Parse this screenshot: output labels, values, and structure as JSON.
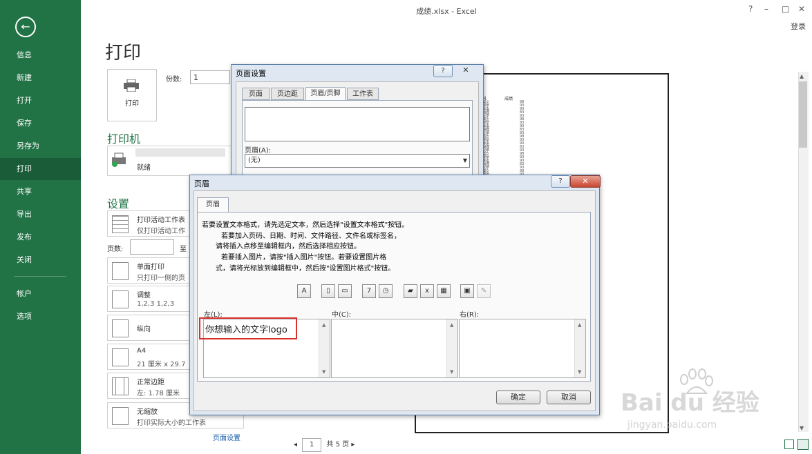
{
  "window": {
    "title": "成绩.xlsx - Excel",
    "help": "?",
    "minimize": "–",
    "maximize": "□",
    "close": "✕",
    "login": "登录"
  },
  "nav": {
    "back_icon": "←",
    "items": [
      {
        "label": "信息"
      },
      {
        "label": "新建"
      },
      {
        "label": "打开"
      },
      {
        "label": "保存"
      },
      {
        "label": "另存为"
      },
      {
        "label": "打印"
      },
      {
        "label": "共享"
      },
      {
        "label": "导出"
      },
      {
        "label": "发布"
      },
      {
        "label": "关闭"
      },
      {
        "label": "帐户"
      },
      {
        "label": "选项"
      }
    ]
  },
  "print": {
    "title": "打印",
    "button": "打印",
    "copies_label": "份数:",
    "copies_value": "1",
    "printer_section": "打印机",
    "printer_status": "就绪",
    "settings_section": "设置",
    "settings": [
      {
        "line1": "打印活动工作表",
        "line2": "仅打印活动工作"
      },
      {
        "line1": "单面打印",
        "line2": "只打印一侧的页"
      },
      {
        "line1": "调整",
        "line2": "1,2,3    1,2,3"
      },
      {
        "line1": "纵向",
        "line2": ""
      },
      {
        "line1": "A4",
        "line2": "21 厘米 x 29.7"
      },
      {
        "line1": "正常边距",
        "line2": "左: 1.78 厘米"
      },
      {
        "line1": "无缩放",
        "line2": "打印实际大小的工作表"
      }
    ],
    "pages_label": "页数:",
    "pages_to": "至",
    "page_setup_link": "页面设置",
    "pager_current": "1",
    "pager_total": "共 5 页"
  },
  "preview": {
    "col_a": "科",
    "col_b": "成绩",
    "rows": [
      [
        "语文",
        "98"
      ],
      [
        "数学",
        "93"
      ],
      [
        "英语",
        "90"
      ],
      [
        "物理",
        "83"
      ],
      [
        "化学",
        "93"
      ],
      [
        "语文",
        "98"
      ],
      [
        "数学",
        "93"
      ],
      [
        "英语",
        "90"
      ],
      [
        "物理",
        "83"
      ],
      [
        "化学",
        "93"
      ],
      [
        "语文",
        "98"
      ],
      [
        "数学",
        "93"
      ],
      [
        "英语",
        "90"
      ],
      [
        "物理",
        "83"
      ],
      [
        "化学",
        "93"
      ],
      [
        "语文",
        "98"
      ],
      [
        "数学",
        "93"
      ],
      [
        "英语",
        "90"
      ],
      [
        "物理",
        "83"
      ],
      [
        "化学",
        "93"
      ],
      [
        "语文",
        "98"
      ],
      [
        "数学",
        "93"
      ]
    ]
  },
  "page_setup": {
    "title": "页面设置",
    "help": "?",
    "close": "✕",
    "tabs": [
      "页面",
      "页边距",
      "页眉/页脚",
      "工作表"
    ],
    "active_tab": 2,
    "header_label": "页眉(A):",
    "header_value": "(无)"
  },
  "header_dialog": {
    "title": "页眉",
    "help": "?",
    "close": "✕",
    "tab": "页眉",
    "instructions": [
      "若要设置文本格式，请先选定文本，然后选择\"设置文本格式\"按钮。",
      "若要加入页码、日期、时间、文件路径、文件名或标签名，",
      "请将插入点移至编辑框内，然后选择相应按钮。",
      "若要插入图片，请按\"插入图片\"按钮。若要设置图片格",
      "式，请将光标放到编辑框中，然后按\"设置图片格式\"按钮。"
    ],
    "left_label": "左(L):",
    "center_label": "中(C):",
    "right_label": "右(R):",
    "left_text": "你想输入的文字logo",
    "center_text": "",
    "right_text": "",
    "ok": "确定",
    "cancel": "取消"
  },
  "watermark": {
    "brand": "Bai  du 经验",
    "url": "jingyan.baidu.com"
  },
  "colors": {
    "nav_bg": "#217346",
    "highlight_box": "#d9302c",
    "section_title": "#217346"
  }
}
